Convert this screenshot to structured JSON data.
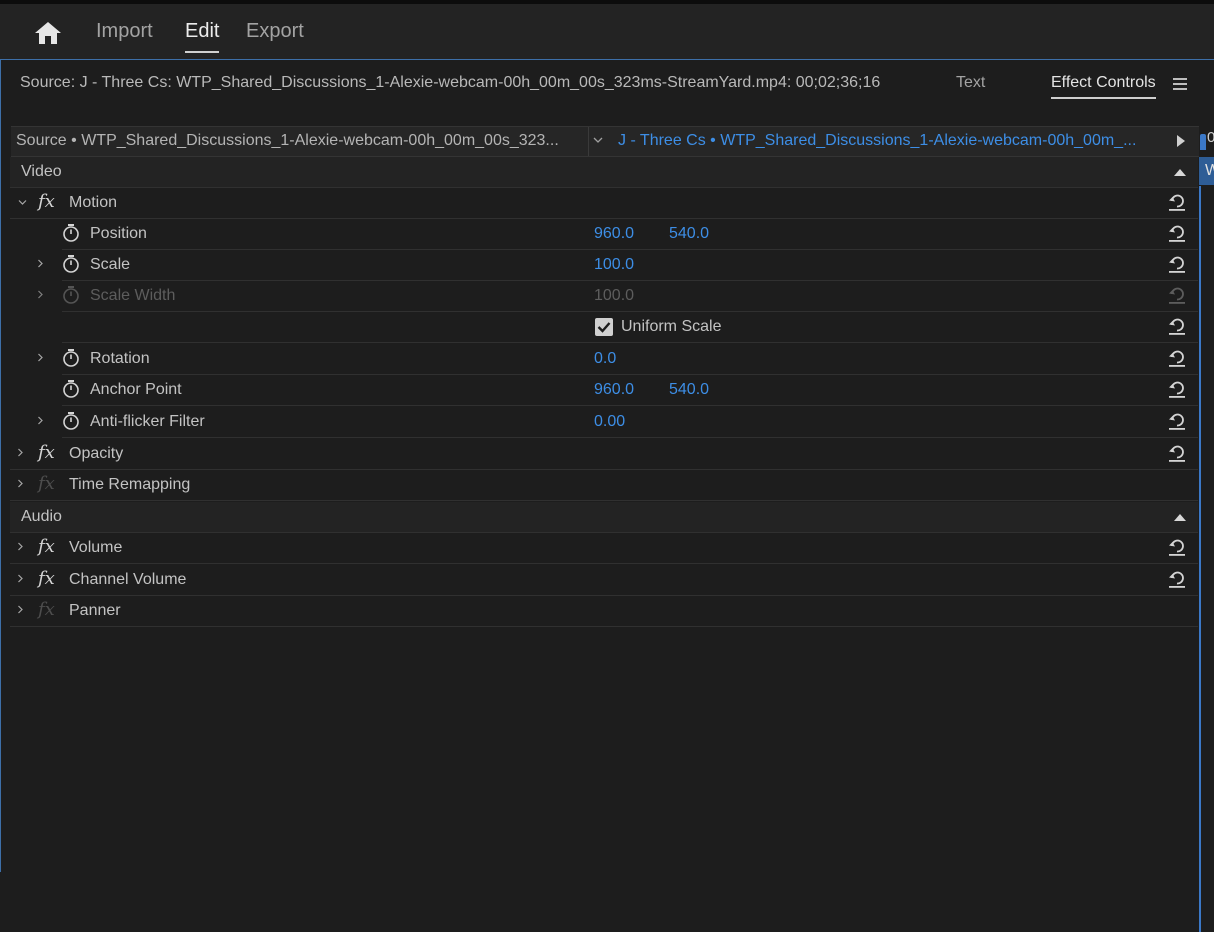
{
  "workspace_tabs": {
    "import": "Import",
    "edit": "Edit",
    "export": "Export"
  },
  "panel": {
    "source_label": "Source: J - Three Cs: WTP_Shared_Discussions_1-Alexie-webcam-00h_00m_00s_323ms-StreamYard.mp4: 00;02;36;16",
    "tabs": {
      "text": "Text",
      "effect_controls": "Effect Controls"
    }
  },
  "clip_header": {
    "source": "Source • WTP_Shared_Discussions_1-Alexie-webcam-00h_00m_00s_323...",
    "sequence": "J - Three Cs • WTP_Shared_Discussions_1-Alexie-webcam-00h_00m_..."
  },
  "timeline": {
    "tick_label": "0",
    "clip_label": "W"
  },
  "sections": {
    "video": "Video",
    "audio": "Audio"
  },
  "effects": {
    "motion": {
      "name": "Motion",
      "position": {
        "label": "Position",
        "x": "960.0",
        "y": "540.0"
      },
      "scale": {
        "label": "Scale",
        "value": "100.0"
      },
      "scale_width": {
        "label": "Scale Width",
        "value": "100.0"
      },
      "uniform_scale": {
        "label": "Uniform Scale",
        "checked": true
      },
      "rotation": {
        "label": "Rotation",
        "value": "0.0"
      },
      "anchor_point": {
        "label": "Anchor Point",
        "x": "960.0",
        "y": "540.0"
      },
      "anti_flicker": {
        "label": "Anti-flicker Filter",
        "value": "0.00"
      }
    },
    "opacity": "Opacity",
    "time_remapping": "Time Remapping",
    "volume": "Volume",
    "channel_volume": "Channel Volume",
    "panner": "Panner"
  },
  "colors": {
    "accent_blue": "#3d8ee6",
    "panel_bg": "#1d1d1d",
    "focus_border": "#3b78c7"
  }
}
